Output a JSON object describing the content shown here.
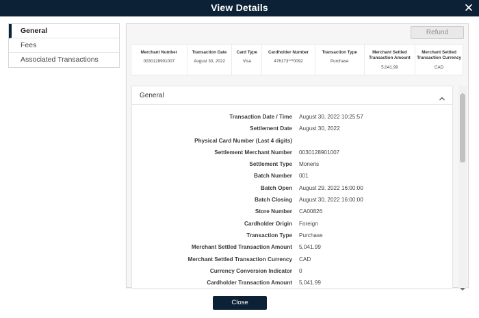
{
  "window": {
    "title": "View Details",
    "close_icon": "close-icon"
  },
  "sidebar": {
    "items": [
      {
        "label": "General",
        "active": true
      },
      {
        "label": "Fees",
        "active": false
      },
      {
        "label": "Associated Transactions",
        "active": false
      }
    ]
  },
  "toolbar": {
    "refund_label": "Refund"
  },
  "summary": {
    "columns": [
      {
        "header": "Merchant Number",
        "value": "0030128901007"
      },
      {
        "header": "Transaction Date",
        "value": "August 30, 2022"
      },
      {
        "header": "Card Type",
        "value": "Visa"
      },
      {
        "header": "Cardholder Number",
        "value": "476173***0092"
      },
      {
        "header": "Transaction Type",
        "value": "Purchase"
      },
      {
        "header_line1": "Merchant Settled",
        "header_line2": "Transaction Amount",
        "value": "5,041.99"
      },
      {
        "header_line1": "Merchant Settled",
        "header_line2": "Transaction Currency",
        "value": "CAD"
      }
    ]
  },
  "general": {
    "title": "General",
    "rows": [
      {
        "label": "Transaction Date / Time",
        "value": "August 30, 2022 10:25:57"
      },
      {
        "label": "Settlement Date",
        "value": "August 30, 2022"
      },
      {
        "label": "Physical Card Number (Last 4 digits)",
        "value": ""
      },
      {
        "label": "Settlement Merchant Number",
        "value": "0030128901007"
      },
      {
        "label": "Settlement Type",
        "value": "Moneris"
      },
      {
        "label": "Batch Number",
        "value": "001"
      },
      {
        "label": "Batch Open",
        "value": "August 29, 2022 16:00:00"
      },
      {
        "label": "Batch Closing",
        "value": "August 30, 2022 16:00:00"
      },
      {
        "label": "Store Number",
        "value": "CA00826"
      },
      {
        "label": "Cardholder Origin",
        "value": "Foreign"
      },
      {
        "label": "Transaction Type",
        "value": "Purchase"
      },
      {
        "label": "Merchant Settled Transaction Amount",
        "value": "5,041.99"
      },
      {
        "label": "Merchant Settled Transaction Currency",
        "value": "CAD"
      },
      {
        "label": "Currency Conversion Indicator",
        "value": "0"
      },
      {
        "label": "Cardholder Transaction Amount",
        "value": "5,041.99"
      }
    ]
  },
  "footer": {
    "close_label": "Close"
  },
  "colors": {
    "navy": "#0c2136",
    "refund_disabled_bg": "#e9e9e9"
  }
}
